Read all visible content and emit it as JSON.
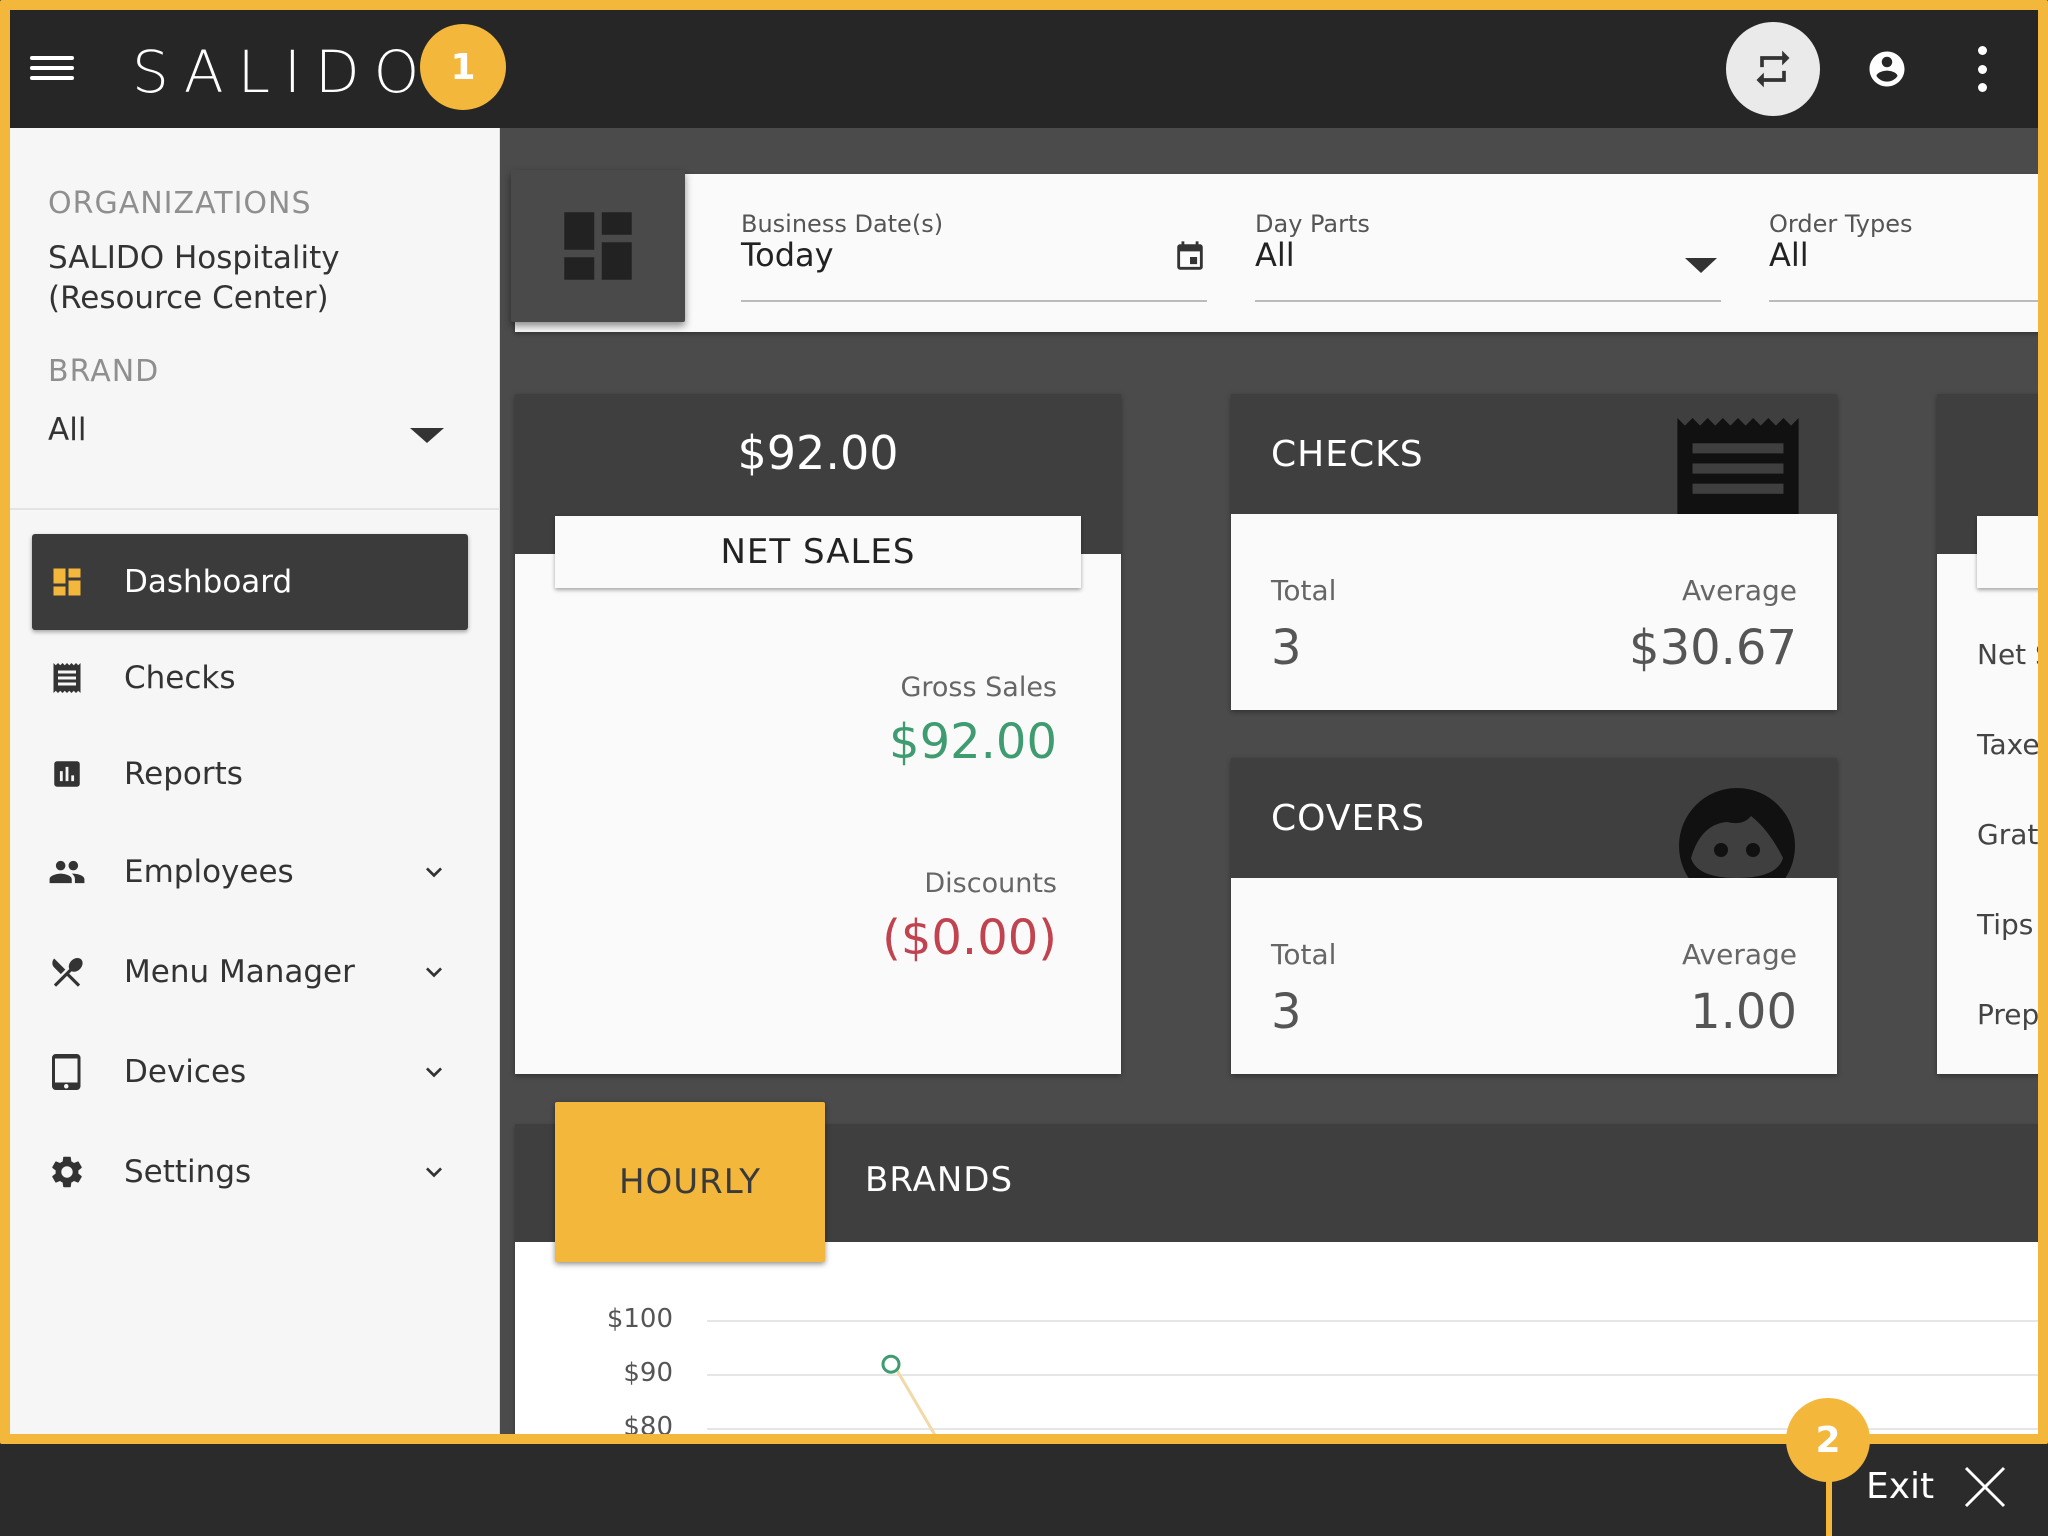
{
  "header": {
    "logo_text": "SALIDO",
    "badge_1": "1"
  },
  "sidebar": {
    "organizations_label": "ORGANIZATIONS",
    "organization_name": "SALIDO Hospitality (Resource Center)",
    "brand_label": "BRAND",
    "brand_value": "All",
    "items": [
      {
        "label": "Dashboard",
        "icon": "dashboard-icon"
      },
      {
        "label": "Checks",
        "icon": "receipt-icon"
      },
      {
        "label": "Reports",
        "icon": "bar-chart-icon"
      },
      {
        "label": "Employees",
        "icon": "people-icon"
      },
      {
        "label": "Menu Manager",
        "icon": "utensils-icon"
      },
      {
        "label": "Devices",
        "icon": "tablet-icon"
      },
      {
        "label": "Settings",
        "icon": "gear-icon"
      }
    ]
  },
  "filters": {
    "business_date_label": "Business Date(s)",
    "business_date_value": "Today",
    "day_parts_label": "Day Parts",
    "day_parts_value": "All",
    "order_types_label": "Order Types",
    "order_types_value": "All"
  },
  "net_sales": {
    "amount": "$92.00",
    "title": "NET SALES",
    "gross_label": "Gross Sales",
    "gross_value": "$92.00",
    "discounts_label": "Discounts",
    "discounts_value": "($0.00)"
  },
  "checks": {
    "title": "CHECKS",
    "total_label": "Total",
    "total_value": "3",
    "average_label": "Average",
    "average_value": "$30.67"
  },
  "covers": {
    "title": "COVERS",
    "total_label": "Total",
    "total_value": "3",
    "average_label": "Average",
    "average_value": "1.00"
  },
  "side_card": {
    "rows": [
      "Net S",
      "Taxes",
      "Gratu",
      "Tips",
      "Prepa"
    ]
  },
  "tabs": {
    "hourly": "HOURLY",
    "brands": "BRANDS"
  },
  "chart_data": {
    "type": "line",
    "y_ticks": [
      "$100",
      "$90",
      "$80"
    ],
    "ylim": [
      80,
      100
    ],
    "series": [
      {
        "values": [
          92
        ]
      }
    ]
  },
  "footer": {
    "badge_2": "2",
    "exit_label": "Exit"
  },
  "colors": {
    "accent": "#f3b73b",
    "positive": "#3f9b70",
    "negative": "#c0434f",
    "dark": "#3f3f3f"
  }
}
